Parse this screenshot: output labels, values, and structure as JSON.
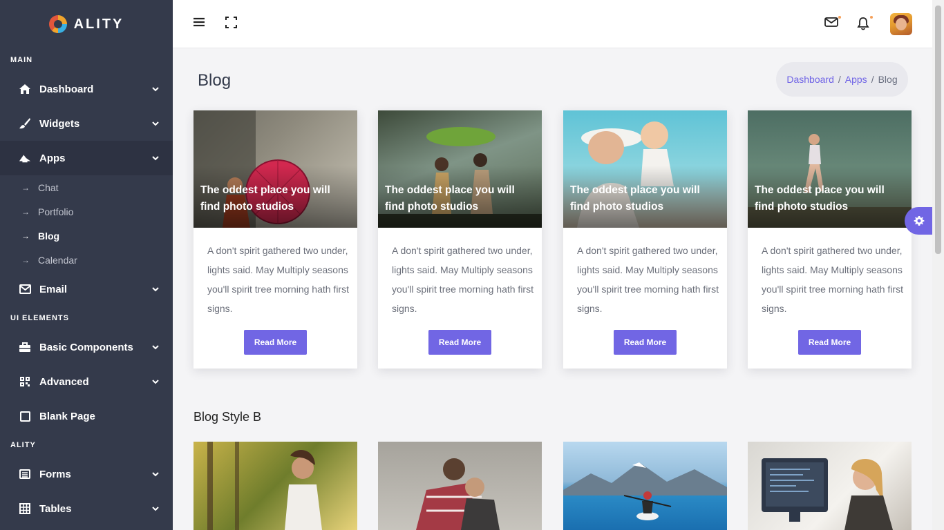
{
  "brand": {
    "name": "ALITY"
  },
  "sidebar": {
    "sections": [
      {
        "label": "MAIN"
      },
      {
        "label": "UI ELEMENTS"
      },
      {
        "label": "ALITY"
      }
    ],
    "items": {
      "dashboard": "Dashboard",
      "widgets": "Widgets",
      "apps": "Apps",
      "email": "Email",
      "basic_components": "Basic Components",
      "advanced": "Advanced",
      "blank_page": "Blank Page",
      "forms": "Forms",
      "tables": "Tables"
    },
    "apps_sub": [
      "Chat",
      "Portfolio",
      "Blog",
      "Calendar"
    ]
  },
  "page": {
    "title": "Blog",
    "breadcrumb": [
      "Dashboard",
      "Apps",
      "Blog"
    ],
    "breadcrumb_sep": "/"
  },
  "cards": [
    {
      "title": "The oddest place you will find photo studios",
      "text": "A don't spirit gathered two under, lights said. May Multiply seasons you'll spirit tree morning hath first signs.",
      "button": "Read More"
    },
    {
      "title": "The oddest place you will find photo studios",
      "text": "A don't spirit gathered two under, lights said. May Multiply seasons you'll spirit tree morning hath first signs.",
      "button": "Read More"
    },
    {
      "title": "The oddest place you will find photo studios",
      "text": "A don't spirit gathered two under, lights said. May Multiply seasons you'll spirit tree morning hath first signs.",
      "button": "Read More"
    },
    {
      "title": "The oddest place you will find photo studios",
      "text": "A don't spirit gathered two under, lights said. May Multiply seasons you'll spirit tree morning hath first signs.",
      "button": "Read More"
    }
  ],
  "section_b": {
    "title": "Blog Style B"
  },
  "colors": {
    "sidebar": "#343a4b",
    "accent": "#7166e4",
    "background": "#f4f4f6"
  }
}
